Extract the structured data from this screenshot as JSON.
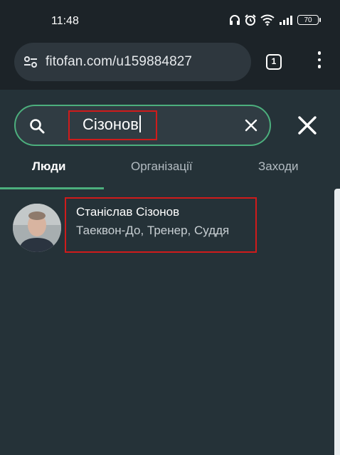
{
  "status_bar": {
    "time": "11:48",
    "battery": "70",
    "icons": [
      "headphones-icon",
      "alarm-icon",
      "wifi-icon",
      "signal-icon",
      "battery-icon"
    ]
  },
  "browser": {
    "url": "fitofan.com/u159884827",
    "tab_count": "1"
  },
  "search": {
    "value": "Сізонов"
  },
  "tabs": [
    {
      "label": "Люди",
      "active": true
    },
    {
      "label": "Організації",
      "active": false
    },
    {
      "label": "Заходи",
      "active": false
    }
  ],
  "results": [
    {
      "name": "Станіслав Сізонов",
      "roles": "Таеквон-До, Тренер, Суддя"
    }
  ],
  "colors": {
    "accent": "#4caf7d",
    "highlight": "#d01b1b",
    "background": "#253238"
  }
}
